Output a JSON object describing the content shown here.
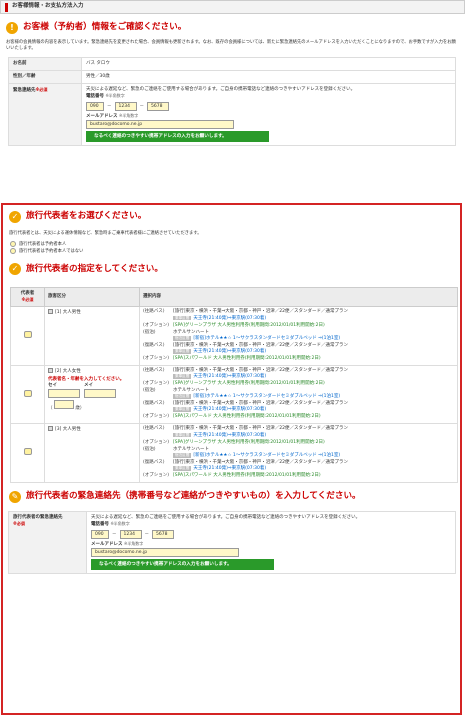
{
  "header": {
    "title": "お客様情報・お支払方法入力"
  },
  "section1": {
    "icon": "!",
    "title": "お客様（予約者）情報をご確認ください。",
    "intro": "お客様の会員情報の内容を表示しています。緊急連絡先を変更された場合、会員情報も更新されます。なお、既存の会員様については、新たに緊急連絡先のメールアドレスを入力いただくことになりますので、お手数ですが入力をお願いいたします。",
    "name_label": "お名前",
    "name_value": "バス タロウ",
    "gender_label": "性別／年齢",
    "gender_value": "男性／30歳",
    "emergency_label": "緊急連絡先",
    "required": "※必須",
    "emergency_note": "天災による遅延など、緊急のご連絡をご使用する場合があります。ご自身の携帯電話など連絡のつきやすいアドレスを登録ください。",
    "tel_label": "電話番号",
    "halfwidth": "※半角数字",
    "tel1": "090",
    "tel2": "1234",
    "tel3": "5678",
    "dash": "－",
    "mail_label": "メールアドレス",
    "mail_value": "bustaro@docomo.ne.jp",
    "green_note": "なるべく連絡のつきやすい携帯アドレスの入力をお願いします。"
  },
  "section2": {
    "icon": "✓",
    "title": "旅行代表者をお選びください。",
    "intro": "旅行代表者とは、天災による運休情報など、緊急時まご乗車代表者様にご連絡させていただきます。",
    "opt1": "旅行代表者は予約者本人",
    "opt2": "旅行代表者は予約者本人ではない"
  },
  "section3": {
    "icon": "✓",
    "title": "旅行代表者の指定をしてください。",
    "col_rep": "代表者",
    "col_req": "※必須",
    "col_class": "旅客区分",
    "col_content": "選択内容",
    "rows": [
      {
        "cls": "[1] 大人男性",
        "items": [
          {
            "k": "(往路バス)",
            "v": "[旅行]東京・横浜・千葉⇒大阪・京都・神戸・沼津／22便／スタンダード／通常プラン",
            "chip": "乗車区間",
            "link": "天王寺(21:40発)⇒東京駅(07:30着)"
          },
          {
            "k": "(オプション)",
            "v": "[SPA]グリーンプラザ 大人男性利用券(利用期間:2012/01/01利用開始:2日)"
          },
          {
            "k": "(宿泊)",
            "v": "ホテルサンハート",
            "chip": "宿泊区間",
            "link": "[新宿]ホテル★★☆ 1〜サクラスタンダードセミダブルベッド ⇒(1泊1室)"
          },
          {
            "k": "(復路バス)",
            "v": "[旅行]東京・横浜・千葉⇒大阪・京都・神戸・沼津／22便／スタンダード／通常プラン",
            "chip": "乗車区間",
            "link": "天王寺(21:40発)⇒東京駅(07:30着)"
          },
          {
            "k": "(オプション)",
            "v": "[SPA]スパワールド 大人男性利用券(利用期間:2012/01/01利用開始:2日)"
          }
        ]
      },
      {
        "cls": "[2] 大人女性",
        "warn": "代表者名・年齢を入力してください。",
        "sei": "セイ",
        "mei": "メイ",
        "age": "歳",
        "items": [
          {
            "k": "(往路バス)",
            "v": "[旅行]東京・横浜・千葉⇒大阪・京都・神戸・沼津／22便／スタンダード／通常プラン",
            "chip": "乗車区間",
            "link": "天王寺(21:40発)⇒東京駅(07:30着)"
          },
          {
            "k": "(オプション)",
            "v": "[SPA]グリーンプラザ 大人男性利用券(利用期間:2012/01/01利用開始:2日)"
          },
          {
            "k": "(宿泊)",
            "v": "ホテルサンハート",
            "chip": "宿泊区間",
            "link": "[新宿]ホテル★★☆ 1〜サクラスタンダードセミダブルベッド ⇒(1泊1室)"
          },
          {
            "k": "(復路バス)",
            "v": "[旅行]東京・横浜・千葉⇒大阪・京都・神戸・沼津／22便／スタンダード／通常プラン",
            "chip": "乗車区間",
            "link": "天王寺(21:40発)⇒東京駅(07:30着)"
          },
          {
            "k": "(オプション)",
            "v": "[SPA]スパワールド 大人男性利用券(利用期間:2012/01/01利用開始:2日)"
          }
        ]
      },
      {
        "cls": "[3] 大人男性",
        "items": [
          {
            "k": "(往路バス)",
            "v": "[旅行]東京・横浜・千葉⇒大阪・京都・神戸・沼津／22便／スタンダード／通常プラン",
            "chip": "乗車区間",
            "link": "天王寺(21:40発)⇒東京駅(07:30着)"
          },
          {
            "k": "(オプション)",
            "v": "[SPA]グリーンプラザ 大人男性利用券(利用期間:2012/01/01利用開始:2日)"
          },
          {
            "k": "(宿泊)",
            "v": "ホテルサンハート",
            "chip": "宿泊区間",
            "link": "[新宿]ホテル★★☆ 1〜サクラスタンダードセミダブルベッド ⇒(1泊1室)"
          },
          {
            "k": "(復路バス)",
            "v": "[旅行]東京・横浜・千葉⇒大阪・京都・神戸・沼津／22便／スタンダード／通常プラン",
            "chip": "乗車区間",
            "link": "天王寺(21:40発)⇒東京駅(07:30着)"
          },
          {
            "k": "(オプション)",
            "v": "[SPA]スパワールド 大人男性利用券(利用期間:2012/01/01利用開始:2日)"
          }
        ]
      }
    ]
  },
  "section4": {
    "icon": "✎",
    "title": "旅行代表者の緊急連絡先（携帯番号など連絡がつきやすいもの）を入力してください。",
    "label": "旅行代表者の緊急連絡先",
    "required": "※必須",
    "note": "天災による遅延など、緊急のご連絡をご使用する場合があります。ご自身の携帯電話など連絡のつきやすいアドレスを登録ください。",
    "tel_label": "電話番号",
    "halfwidth": "※半角数字",
    "tel1": "090",
    "tel2": "1234",
    "tel3": "5678",
    "dash": "－",
    "mail_label": "メールアドレス",
    "mail_value": "bustaro@docomo.ne.jp",
    "green_note": "なるべく連絡のつきやすい携帯アドレスの入力をお願いします。"
  }
}
